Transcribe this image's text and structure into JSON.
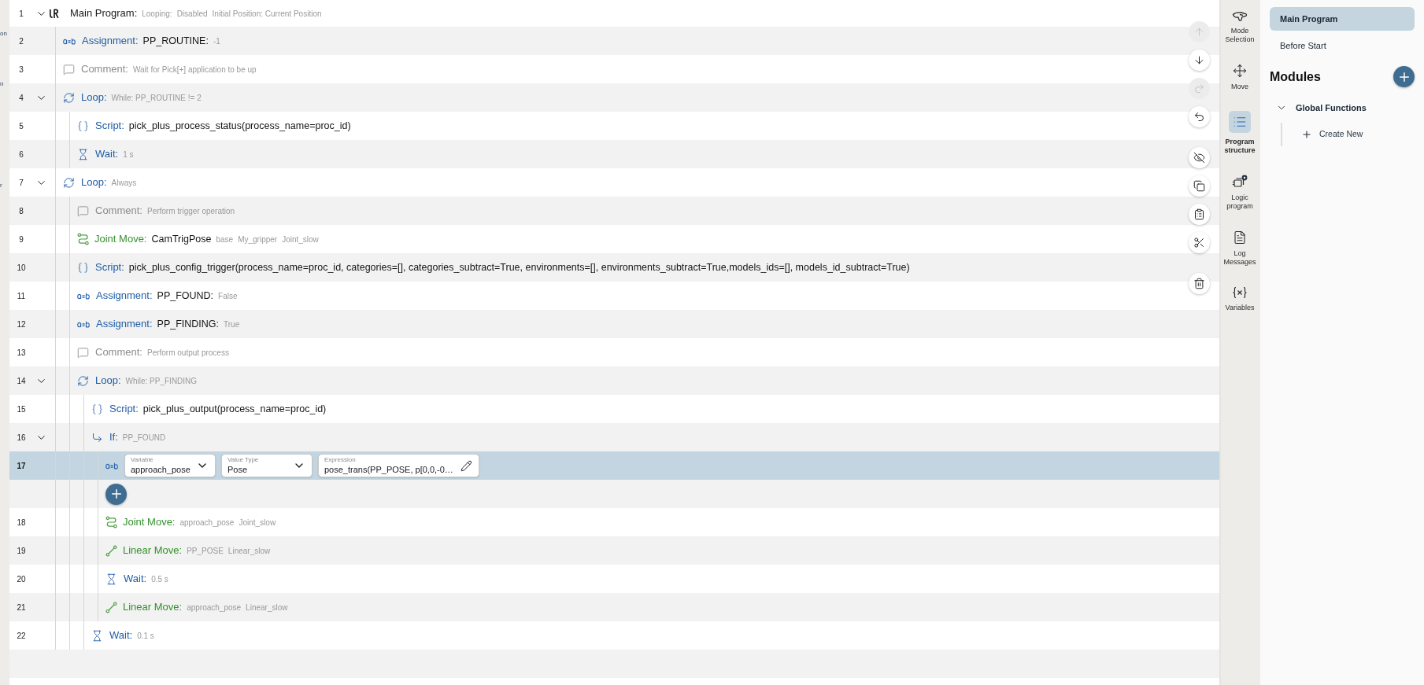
{
  "edge_labels": [
    "on",
    "n",
    "r"
  ],
  "program": {
    "rows": [
      {
        "number": "1",
        "kind": "program",
        "label": "Main Program:",
        "details": [
          "Looping:",
          "Disabled",
          "Initial Position: Current Position"
        ],
        "expanded": true,
        "selected": false,
        "children": [
          {
            "number": "2",
            "kind": "assignment",
            "label": "Assignment:",
            "value": "PP_ROUTINE:",
            "details": [
              "-1"
            ],
            "selected": false
          },
          {
            "number": "3",
            "kind": "comment",
            "label": "Comment:",
            "details": [
              "Wait for Pick[+] application to be up"
            ],
            "selected": false
          },
          {
            "number": "4",
            "kind": "loop",
            "label": "Loop:",
            "details": [
              "While: PP_ROUTINE != 2"
            ],
            "expanded": true,
            "selected": false,
            "children": [
              {
                "number": "5",
                "kind": "script",
                "label": "Script:",
                "value": "pick_plus_process_status(process_name=proc_id)",
                "selected": false
              },
              {
                "number": "6",
                "kind": "wait",
                "label": "Wait:",
                "details": [
                  "1 s"
                ],
                "selected": false
              }
            ]
          },
          {
            "number": "7",
            "kind": "loop",
            "label": "Loop:",
            "details": [
              "Always"
            ],
            "expanded": true,
            "selected": false,
            "children": [
              {
                "number": "8",
                "kind": "comment",
                "label": "Comment:",
                "details": [
                  "Perform trigger operation"
                ],
                "selected": false
              },
              {
                "number": "9",
                "kind": "joint_move",
                "label": "Joint Move:",
                "value": "CamTrigPose",
                "details": [
                  "base",
                  "My_gripper",
                  "Joint_slow"
                ],
                "selected": false
              },
              {
                "number": "10",
                "kind": "script",
                "label": "Script:",
                "value": "pick_plus_config_trigger(process_name=proc_id, categories=[], categories_subtract=True, environments=[], environments_subtract=True,models_ids=[], models_id_subtract=True)",
                "selected": false
              },
              {
                "number": "11",
                "kind": "assignment",
                "label": "Assignment:",
                "value": "PP_FOUND:",
                "details": [
                  "False"
                ],
                "selected": false
              },
              {
                "number": "12",
                "kind": "assignment",
                "label": "Assignment:",
                "value": "PP_FINDING:",
                "details": [
                  "True"
                ],
                "selected": false
              },
              {
                "number": "13",
                "kind": "comment",
                "label": "Comment:",
                "details": [
                  "Perform output process"
                ],
                "selected": false
              },
              {
                "number": "14",
                "kind": "loop",
                "label": "Loop:",
                "details": [
                  "While: PP_FINDING"
                ],
                "expanded": true,
                "selected": false,
                "children": [
                  {
                    "number": "15",
                    "kind": "script",
                    "label": "Script:",
                    "value": "pick_plus_output(process_name=proc_id)",
                    "selected": false
                  },
                  {
                    "number": "16",
                    "kind": "if",
                    "label": "If:",
                    "details": [
                      "PP_FOUND"
                    ],
                    "expanded": true,
                    "selected": false,
                    "children": [
                      {
                        "number": "17",
                        "kind": "assignment_form",
                        "selected": true,
                        "fields": [
                          {
                            "kind": "dropdown",
                            "label": "Variable",
                            "value": "approach_pose"
                          },
                          {
                            "kind": "dropdown",
                            "label": "Value Type",
                            "value": "Pose"
                          },
                          {
                            "kind": "expression",
                            "label": "Expression",
                            "value": "pose_trans(PP_POSE, p[0,0,-0…"
                          }
                        ]
                      },
                      {
                        "kind": "add",
                        "selected": false
                      },
                      {
                        "number": "18",
                        "kind": "joint_move",
                        "label": "Joint Move:",
                        "details": [
                          "approach_pose",
                          "Joint_slow"
                        ],
                        "selected": false
                      },
                      {
                        "number": "19",
                        "kind": "linear_move",
                        "label": "Linear Move:",
                        "details": [
                          "PP_POSE",
                          "Linear_slow"
                        ],
                        "selected": false
                      },
                      {
                        "number": "20",
                        "kind": "wait",
                        "label": "Wait:",
                        "details": [
                          "0.5 s"
                        ],
                        "selected": false
                      },
                      {
                        "number": "21",
                        "kind": "linear_move",
                        "label": "Linear Move:",
                        "details": [
                          "approach_pose",
                          "Linear_slow"
                        ],
                        "selected": false
                      }
                    ]
                  },
                  {
                    "number": "22",
                    "kind": "wait",
                    "label": "Wait:",
                    "details": [
                      "0.1 s"
                    ],
                    "selected": false
                  }
                ]
              }
            ]
          }
        ]
      }
    ]
  },
  "toolbar": [
    [
      {
        "kind": "up",
        "disabled": true
      },
      {
        "kind": "down",
        "disabled": false
      },
      {
        "kind": "redo",
        "disabled": true
      },
      {
        "kind": "undo",
        "disabled": false
      }
    ],
    [
      {
        "kind": "hide",
        "disabled": false
      },
      {
        "kind": "copy",
        "disabled": false
      },
      {
        "kind": "paste",
        "disabled": false
      },
      {
        "kind": "cut",
        "disabled": false
      }
    ],
    [
      {
        "kind": "delete",
        "disabled": false
      }
    ]
  ],
  "nav_rail": [
    {
      "kind": "mode",
      "label": "Mode Selection",
      "selected": false
    },
    {
      "kind": "move",
      "label": "Move",
      "selected": false
    },
    {
      "kind": "structure",
      "label": "Program structure",
      "selected": true
    },
    {
      "kind": "logic",
      "label": "Logic program",
      "selected": false
    },
    {
      "kind": "log",
      "label": "Log Messages",
      "selected": false
    },
    {
      "kind": "variables",
      "label": "Variables",
      "selected": false
    }
  ],
  "structure": {
    "tabs": [
      {
        "label": "Main Program",
        "selected": true
      },
      {
        "label": "Before Start",
        "selected": false
      }
    ],
    "modules": {
      "title": "Modules",
      "items": [
        {
          "label": "Global Functions",
          "expanded": true,
          "children": [
            {
              "kind": "create",
              "label": "Create New"
            }
          ]
        }
      ]
    }
  }
}
